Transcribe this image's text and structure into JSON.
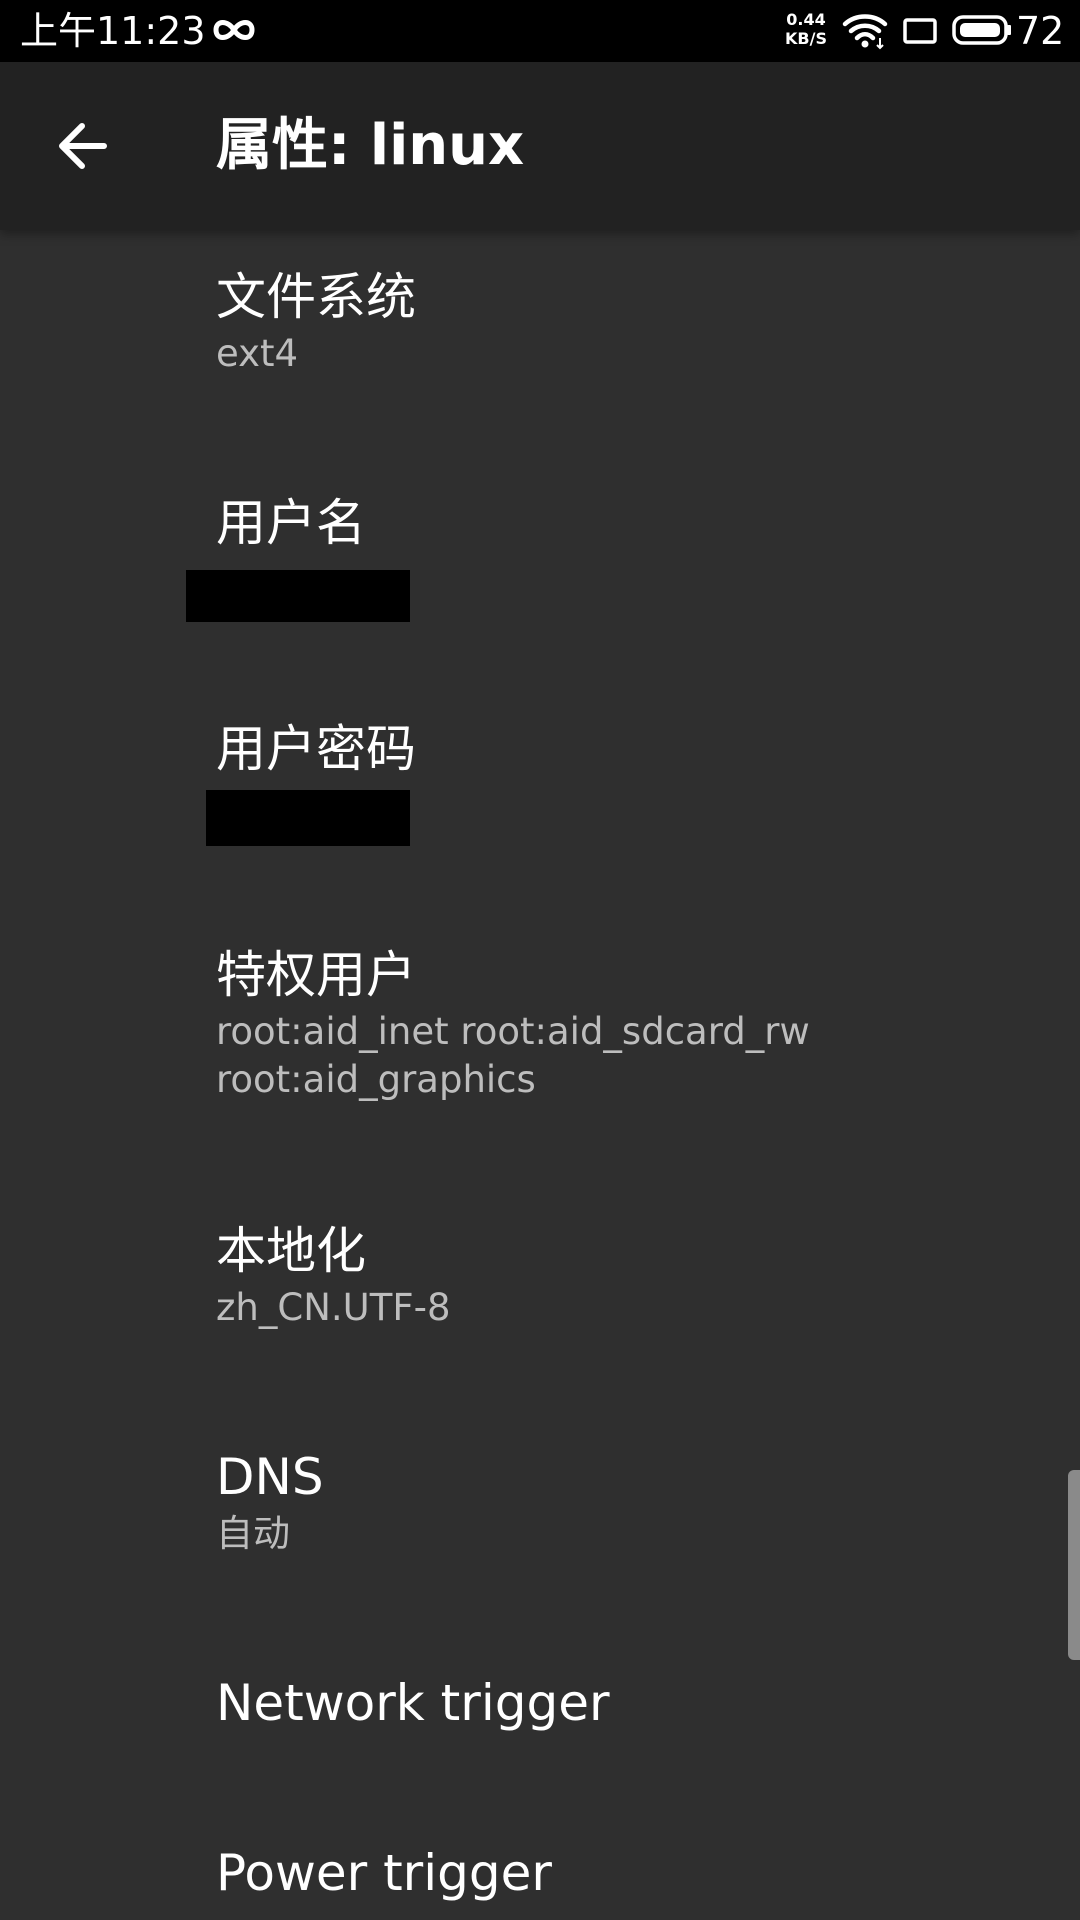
{
  "status_bar": {
    "time": "上午11:23",
    "net_speed_value": "0.44",
    "net_speed_unit": "KB/S",
    "battery": "72",
    "icons": [
      "infinity-icon",
      "wifi-icon",
      "screen-icon",
      "battery-icon"
    ]
  },
  "toolbar": {
    "back_icon": "arrow-back-icon",
    "title": "属性: linux"
  },
  "preferences": [
    {
      "title": "文件系统",
      "summary": "ext4"
    },
    {
      "title": "用户名",
      "summary": ""
    },
    {
      "title": "用户密码",
      "summary": ""
    },
    {
      "title": "特权用户",
      "summary_lines": [
        "root:aid_inet root:aid_sdcard_rw",
        "root:aid_graphics"
      ]
    },
    {
      "title": "本地化",
      "summary": "zh_CN.UTF-8"
    },
    {
      "title": "DNS",
      "summary": "自动"
    },
    {
      "title": "Network trigger"
    },
    {
      "title": "Power trigger"
    }
  ],
  "colors": {
    "background": "#2f2f2f",
    "toolbar": "#222222",
    "status_bar": "#000000",
    "title_text": "#ffffff",
    "summary_text": "#bdbdbd"
  }
}
